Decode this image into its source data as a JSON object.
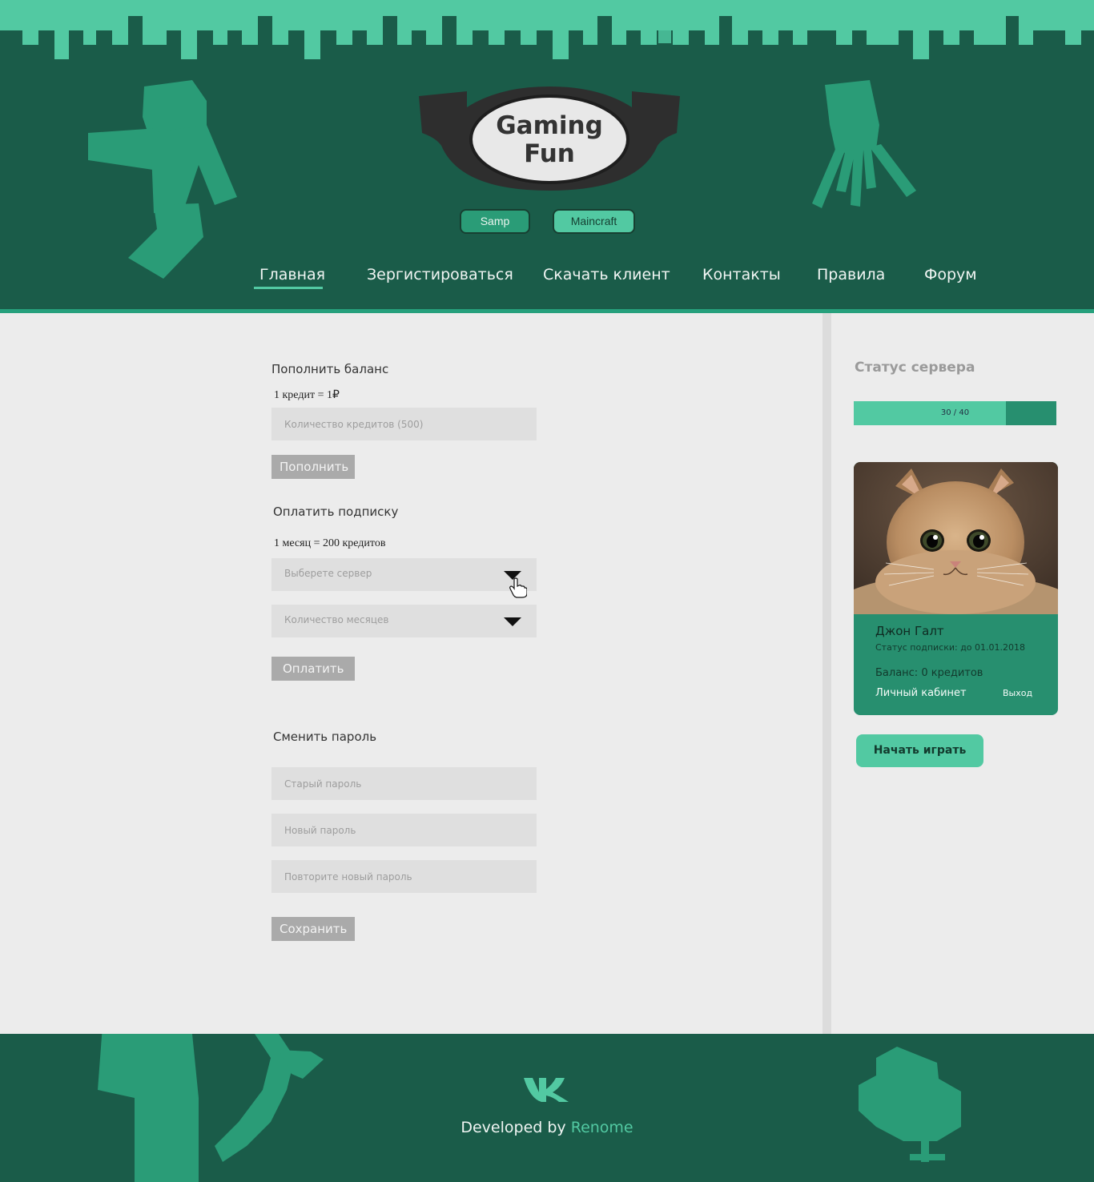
{
  "logo": {
    "line1": "Gaming",
    "line2": "Fun"
  },
  "servers": [
    {
      "label": "Samp"
    },
    {
      "label": "Maincraft"
    }
  ],
  "nav": [
    {
      "label": "Главная",
      "active": true
    },
    {
      "label": "Зергистироваться"
    },
    {
      "label": "Скачать клиент"
    },
    {
      "label": "Контакты"
    },
    {
      "label": "Правила"
    },
    {
      "label": "Форум"
    }
  ],
  "balance": {
    "title": "Пополнить баланс",
    "rate": "1 кредит = 1₽",
    "placeholder": "Количество кредитов (500)",
    "button": "Пополнить"
  },
  "subscription": {
    "title": "Оплатить подписку",
    "rate": "1 месяц = 200 кредитов",
    "server_select": "Выберете сервер",
    "months_select": "Количество месяцев",
    "button": "Оплатить"
  },
  "password": {
    "title": "Сменить пароль",
    "old_placeholder": "Старый пароль",
    "new_placeholder": "Новый пароль",
    "repeat_placeholder": "Повторите новый пароль",
    "button": "Сохранить"
  },
  "sidebar": {
    "status_title": "Статус сервера",
    "online": 30,
    "capacity": 40,
    "status_text": "30 / 40"
  },
  "profile": {
    "name": "Джон Галт",
    "subscription": "Статус подписки: до 01.01.2018",
    "balance": "Баланс: 0 кредитов",
    "cabinet": "Личный кабинет",
    "logout": "Выход"
  },
  "play_button": "Начать играть",
  "footer": {
    "developed_by": "Developed by",
    "developer": "Renome",
    "social_icon": "vk-icon"
  },
  "colors": {
    "dark_green": "#1a5c49",
    "mid_green": "#278f6f",
    "light_green": "#52c9a2",
    "background": "#ececec",
    "field": "#dfdfdf",
    "gray_button": "#aaaaaa"
  }
}
